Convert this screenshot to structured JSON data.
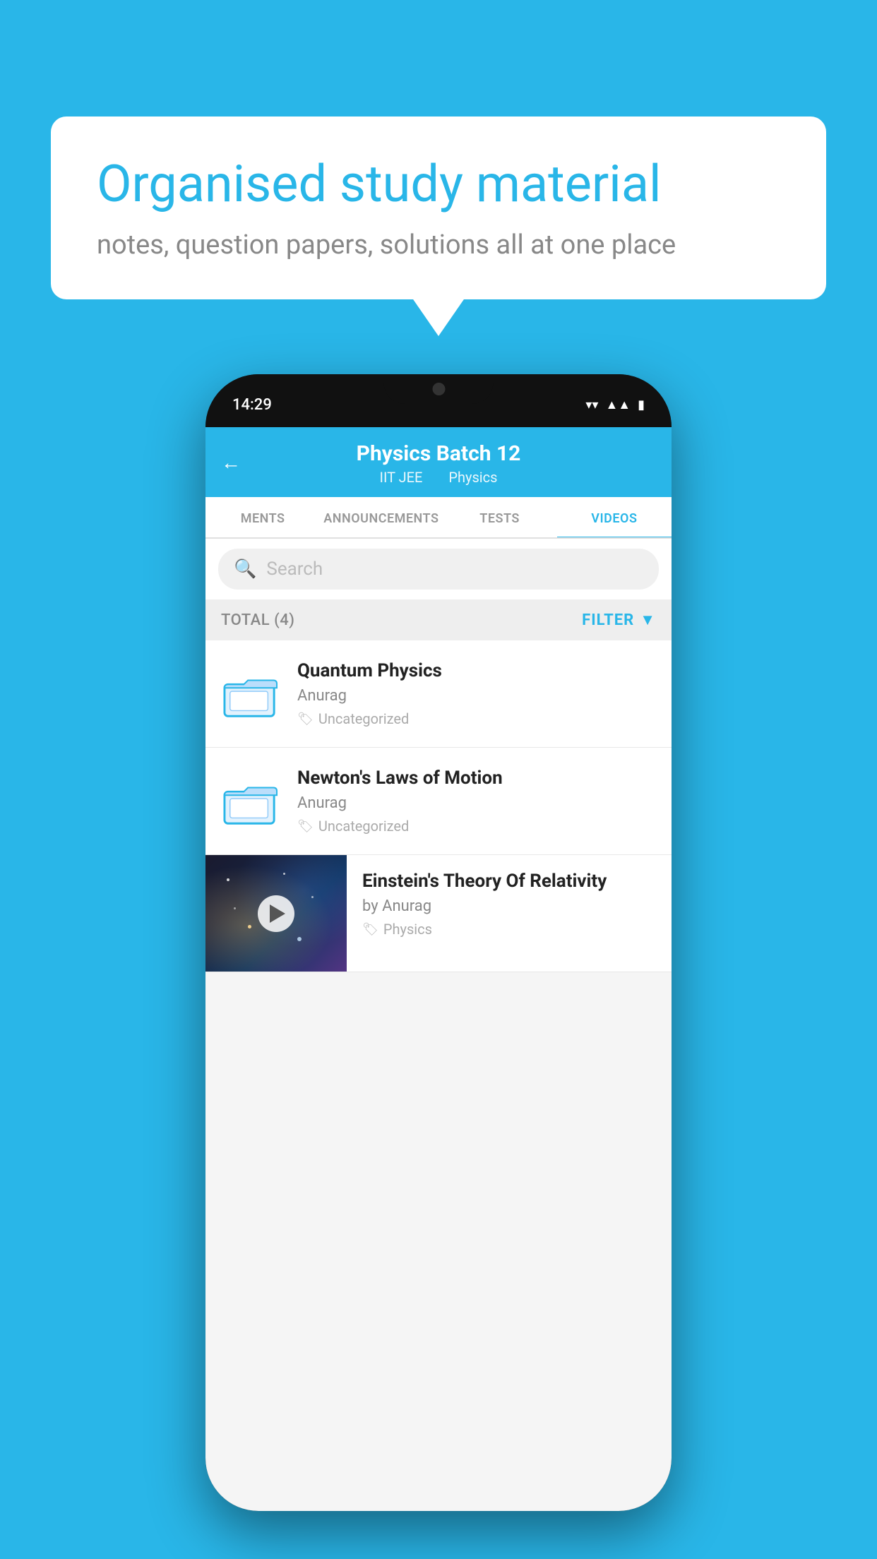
{
  "background": {
    "color": "#29B6E8"
  },
  "speech_bubble": {
    "title": "Organised study material",
    "subtitle": "notes, question papers, solutions all at one place"
  },
  "phone": {
    "status_bar": {
      "time": "14:29"
    },
    "header": {
      "title": "Physics Batch 12",
      "subtitle_part1": "IIT JEE",
      "subtitle_part2": "Physics",
      "back_label": "←"
    },
    "tabs": [
      {
        "label": "MENTS",
        "active": false
      },
      {
        "label": "ANNOUNCEMENTS",
        "active": false
      },
      {
        "label": "TESTS",
        "active": false
      },
      {
        "label": "VIDEOS",
        "active": true
      }
    ],
    "search": {
      "placeholder": "Search"
    },
    "filter_bar": {
      "total_label": "TOTAL (4)",
      "filter_label": "FILTER"
    },
    "videos": [
      {
        "id": "1",
        "title": "Quantum Physics",
        "author": "Anurag",
        "tag": "Uncategorized",
        "type": "folder"
      },
      {
        "id": "2",
        "title": "Newton's Laws of Motion",
        "author": "Anurag",
        "tag": "Uncategorized",
        "type": "folder"
      },
      {
        "id": "3",
        "title": "Einstein's Theory Of Relativity",
        "author": "by Anurag",
        "tag": "Physics",
        "type": "video"
      }
    ]
  }
}
